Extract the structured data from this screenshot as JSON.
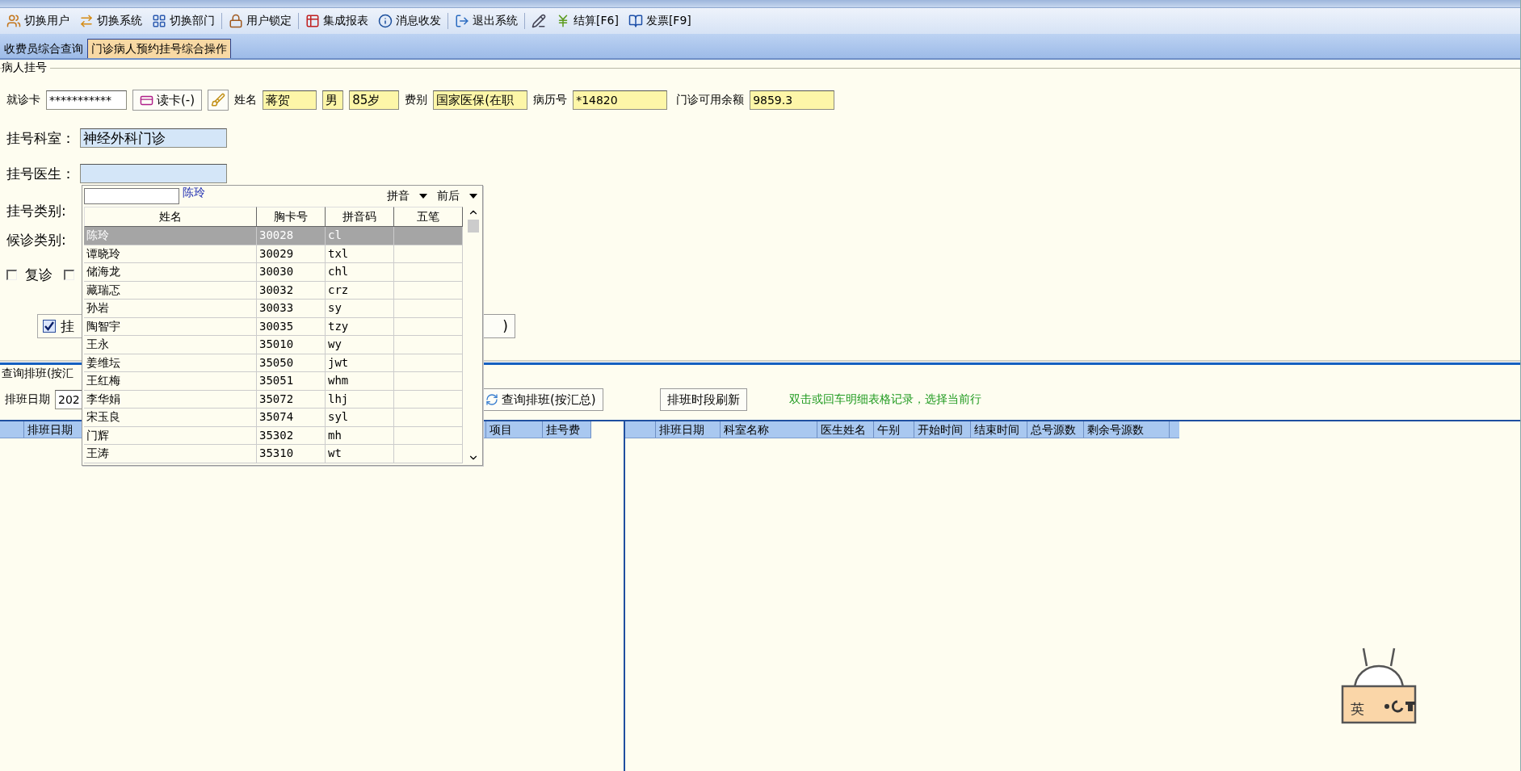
{
  "toolbar": [
    {
      "kind": "button",
      "label": "切换用户"
    },
    {
      "kind": "button",
      "label": "切换系统"
    },
    {
      "kind": "button",
      "label": "切换部门"
    },
    {
      "kind": "button",
      "label": "用户锁定"
    },
    {
      "kind": "button",
      "label": "集成报表"
    },
    {
      "kind": "button",
      "label": "消息收发"
    },
    {
      "kind": "button",
      "label": "退出系统"
    },
    {
      "kind": "icon"
    },
    {
      "kind": "button",
      "label": "结算[F6]"
    },
    {
      "kind": "button",
      "label": "发票[F9]"
    }
  ],
  "tabs": [
    {
      "label": "收费员综合查询",
      "selected": false
    },
    {
      "label": "门诊病人预约挂号综合操作",
      "selected": true
    }
  ],
  "patient": {
    "group_title": "病人挂号",
    "card_label": "就诊卡",
    "card_value": "***********",
    "read_button": "读卡(-)",
    "name_label": "姓名",
    "name": "蒋贺",
    "sex": "男",
    "age": "85岁",
    "fee_label": "费别",
    "fee": "国家医保(在职",
    "record_label": "病历号",
    "record": "*14820",
    "balance_label": "门诊可用余额",
    "balance": "9859.3"
  },
  "form": {
    "department_label": "挂号科室：",
    "department": "神经外科门诊",
    "doctor_label": "挂号医生：",
    "type_label": "挂号类别:",
    "wait_label": "候诊类别:",
    "checkboxes": [
      {
        "label": "复诊",
        "checked": false
      },
      {
        "checked": false
      }
    ],
    "register_check": {
      "label": "挂",
      "checked": true
    },
    "hidden_button": ")"
  },
  "popup": {
    "match": "陈玲",
    "sort_options": [
      "拼音",
      "前后"
    ],
    "columns": [
      "姓名",
      "胸卡号",
      "拼音码",
      "五笔"
    ],
    "rows": [
      {
        "cells": [
          "陈玲",
          "30028",
          "cl"
        ],
        "selected": true
      },
      {
        "cells": [
          "谭晓玲",
          "30029",
          "txl"
        ],
        "selected": false
      },
      {
        "cells": [
          "储海龙",
          "30030",
          "chl"
        ],
        "selected": false
      },
      {
        "cells": [
          "藏瑞忑",
          "30032",
          "crz"
        ],
        "selected": false
      },
      {
        "cells": [
          "孙岩",
          "30033",
          "sy"
        ],
        "selected": false
      },
      {
        "cells": [
          "陶智宇",
          "30035",
          "tzy"
        ],
        "selected": false
      },
      {
        "cells": [
          "王永",
          "35010",
          "wy"
        ],
        "selected": false
      },
      {
        "cells": [
          "姜维坛",
          "35050",
          "jwt"
        ],
        "selected": false
      },
      {
        "cells": [
          "王红梅",
          "35051",
          "whm"
        ],
        "selected": false
      },
      {
        "cells": [
          "李华娟",
          "35072",
          "lhj"
        ],
        "selected": false
      },
      {
        "cells": [
          "宋玉良",
          "35074",
          "syl"
        ],
        "selected": false
      },
      {
        "cells": [
          "门辉",
          "35302",
          "mh"
        ],
        "selected": false
      },
      {
        "cells": [
          "王涛",
          "35310",
          "wt"
        ],
        "selected": false
      }
    ]
  },
  "schedule": {
    "title": "查询排班(按汇",
    "date_label": "排班日期",
    "date": "202",
    "query_button": "查询排班(按汇总)",
    "refresh_button": "排班时段刷新",
    "hint": "双击或回车明细表格记录，选择当前行",
    "left_columns": [
      "排班日期",
      "项目",
      "挂号费"
    ],
    "right_columns": [
      "排班日期",
      "科室名称",
      "医生姓名",
      "午别",
      "开始时间",
      "结束时间",
      "总号源数",
      "剩余号源数"
    ]
  },
  "ime": {
    "label": "英"
  }
}
